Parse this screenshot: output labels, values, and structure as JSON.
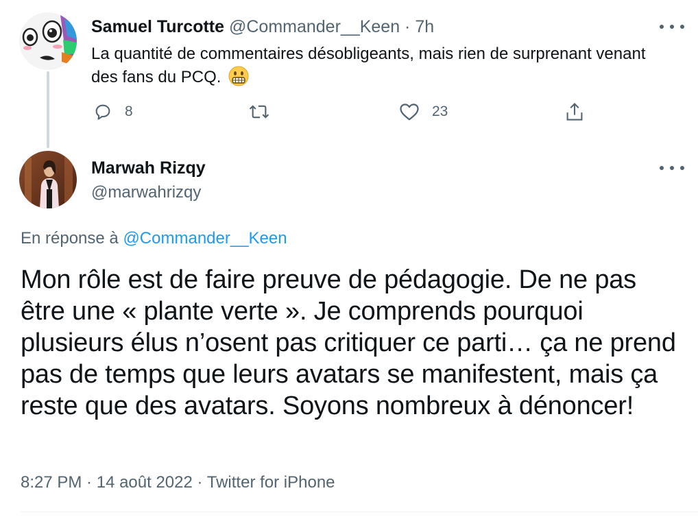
{
  "parent_tweet": {
    "author_name": "Samuel Turcotte",
    "author_handle": "@Commander__Keen",
    "separator": " · ",
    "time": "7h",
    "text": "La quantité de commentaires désobligeants, mais rien de surprenant venant des fans du PCQ.",
    "emoji": "grimacing-face",
    "avatar_icon": "cartoon-face-avatar",
    "actions": {
      "reply_count": "8",
      "retweet_count": "",
      "like_count": "23"
    }
  },
  "main_tweet": {
    "author_name": "Marwah Rizqy",
    "author_handle": "@marwahrizqy",
    "avatar_icon": "photo-avatar",
    "reply_prefix": "En réponse à ",
    "reply_to": "@Commander__Keen",
    "text": "Mon rôle est de faire preuve de pédagogie. De ne pas être une « plante verte ». Je comprends pourquoi plusieurs élus n’osent pas critiquer ce parti… ça ne prend pas de temps que leurs avatars se manifestent, mais ça reste que des avatars. Soyons nombreux à dénoncer!",
    "meta": {
      "time": "8:27 PM",
      "sep": " · ",
      "date": "14 août 2022",
      "source": "Twitter for iPhone"
    }
  },
  "colors": {
    "text": "#0f1419",
    "secondary": "#536471",
    "link": "#1d9bf0",
    "thread_line": "#cfd9de"
  }
}
